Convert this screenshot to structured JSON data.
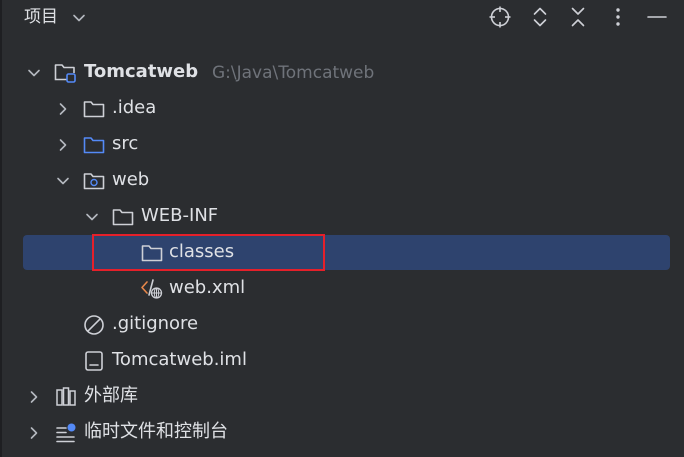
{
  "header": {
    "title": "项目",
    "title_dropdown_icon": "chevron-down-icon",
    "buttons": [
      {
        "name": "locate-icon"
      },
      {
        "name": "expand-all-icon"
      },
      {
        "name": "collapse-all-icon"
      },
      {
        "name": "more-options-icon"
      },
      {
        "name": "minimize-icon"
      }
    ]
  },
  "tree": {
    "items": [
      {
        "label": "Tomcatweb",
        "path": "G:\\Java\\Tomcatweb",
        "icon": "module-folder-icon",
        "expanded": true
      },
      {
        "label": ".idea",
        "icon": "folder-icon",
        "expanded": false
      },
      {
        "label": "src",
        "icon": "source-folder-icon",
        "expanded": false
      },
      {
        "label": "web",
        "icon": "web-folder-icon",
        "expanded": true
      },
      {
        "label": "WEB-INF",
        "icon": "folder-icon",
        "expanded": true
      },
      {
        "label": "classes",
        "icon": "folder-icon",
        "selected": true
      },
      {
        "label": "web.xml",
        "icon": "xml-file-icon"
      },
      {
        "label": ".gitignore",
        "icon": "ignore-file-icon"
      },
      {
        "label": "Tomcatweb.iml",
        "icon": "iml-file-icon"
      },
      {
        "label": "外部库",
        "icon": "library-icon",
        "expanded": false
      },
      {
        "label": "临时文件和控制台",
        "icon": "scratches-icon",
        "expanded": false
      }
    ]
  },
  "colors": {
    "background": "#2b2d30",
    "selection": "#2e436e",
    "highlight_border": "#e5202a",
    "text": "#dfe1e5",
    "muted_text": "#6f737a",
    "source_folder": "#548af7"
  }
}
